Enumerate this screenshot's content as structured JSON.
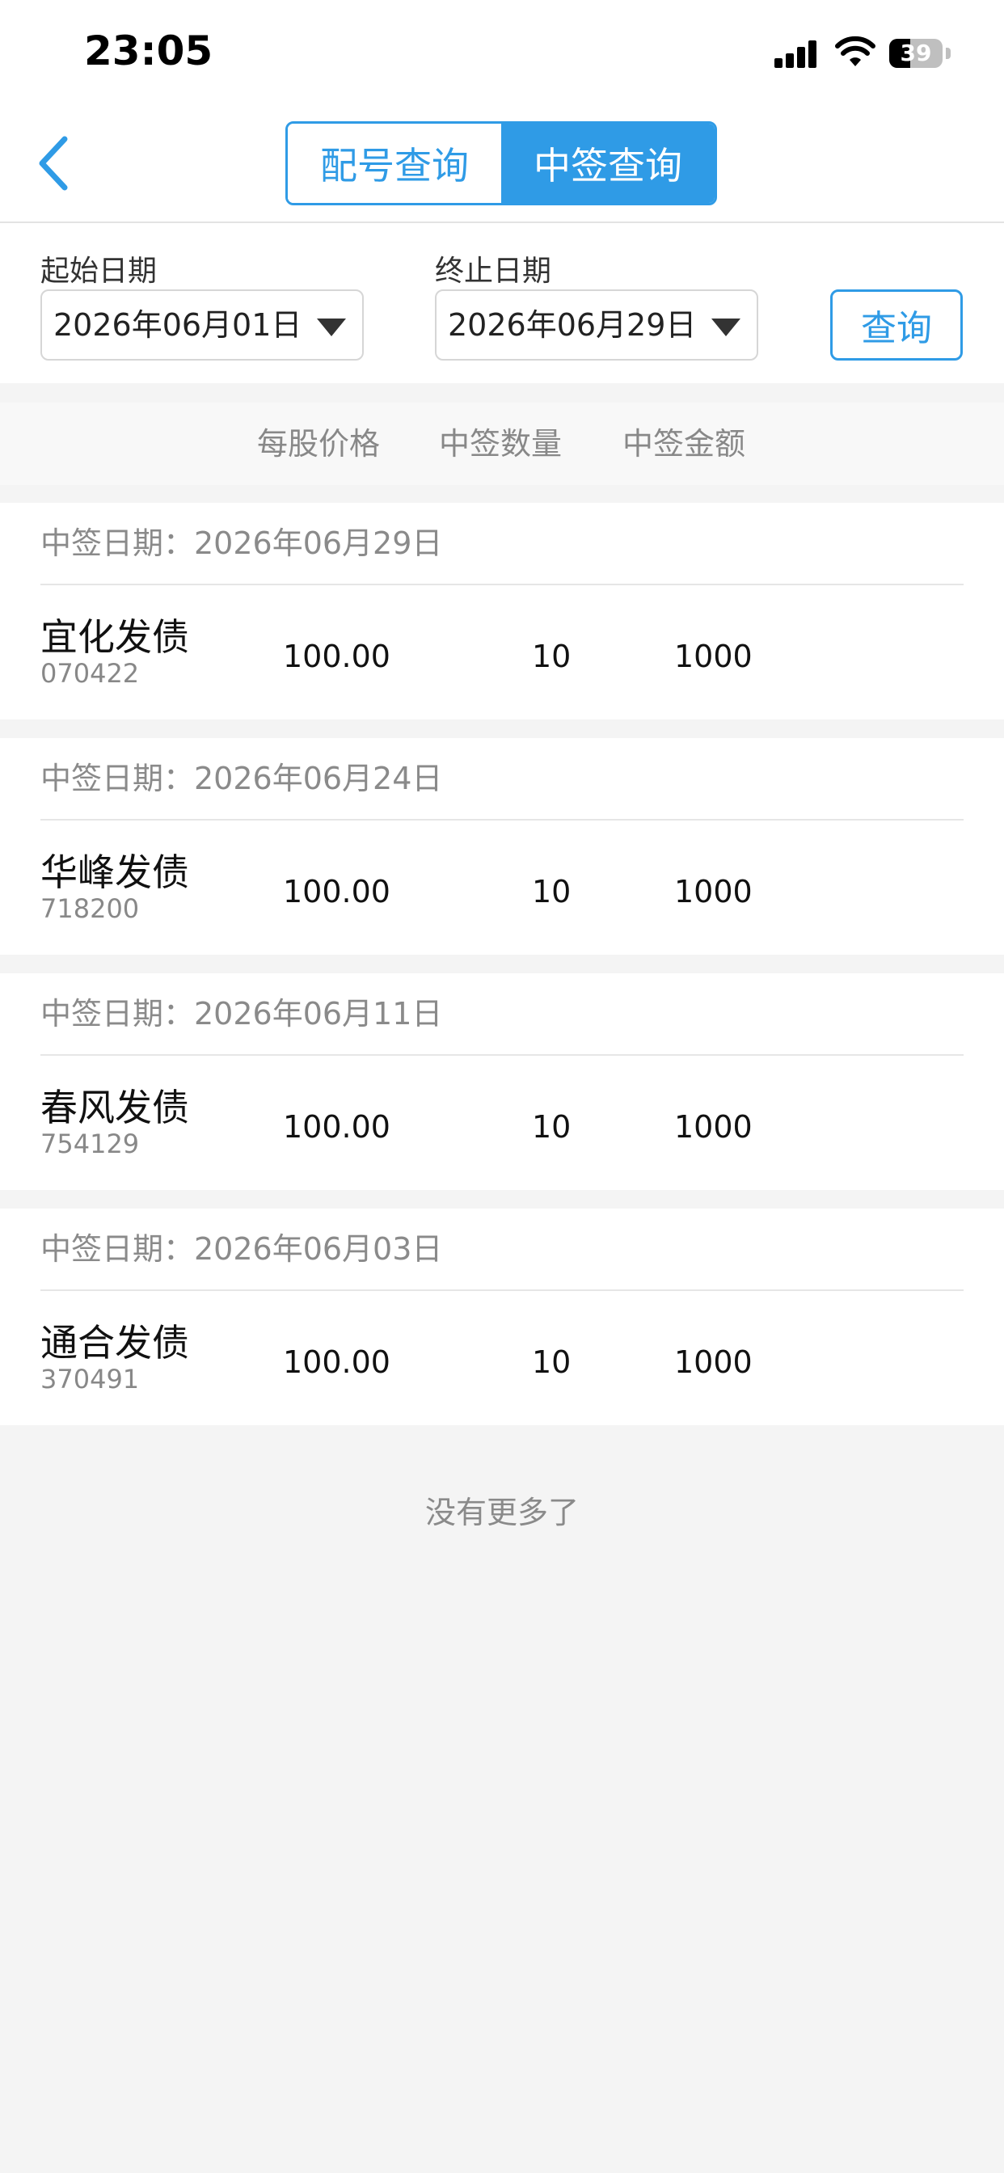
{
  "status_bar": {
    "time": "23:05",
    "battery": "39",
    "battery_level": 0.39
  },
  "nav": {
    "tabs": [
      {
        "label": "配号查询",
        "active": false
      },
      {
        "label": "中签查询",
        "active": true
      }
    ]
  },
  "filter": {
    "start_label": "起始日期",
    "start_value": "2026年06月01日",
    "end_label": "终止日期",
    "end_value": "2026年06月29日",
    "query_label": "查询"
  },
  "table": {
    "headers": [
      "每股价格",
      "中签数量",
      "中签金额"
    ],
    "rows": [
      {
        "date": "中签日期：2026年06月29日",
        "name": "宜化发债",
        "code": "070422",
        "price": "100.00",
        "qty": "10",
        "amount": "1000"
      },
      {
        "date": "中签日期：2026年06月24日",
        "name": "华峰发债",
        "code": "718200",
        "price": "100.00",
        "qty": "10",
        "amount": "1000"
      },
      {
        "date": "中签日期：2026年06月11日",
        "name": "春风发债",
        "code": "754129",
        "price": "100.00",
        "qty": "10",
        "amount": "1000"
      },
      {
        "date": "中签日期：2026年06月03日",
        "name": "通合发债",
        "code": "370491",
        "price": "100.00",
        "qty": "10",
        "amount": "1000"
      }
    ]
  },
  "footer": {
    "no_more": "没有更多了"
  },
  "colors": {
    "accent": "#2f9be6",
    "background": "#f4f4f4"
  }
}
